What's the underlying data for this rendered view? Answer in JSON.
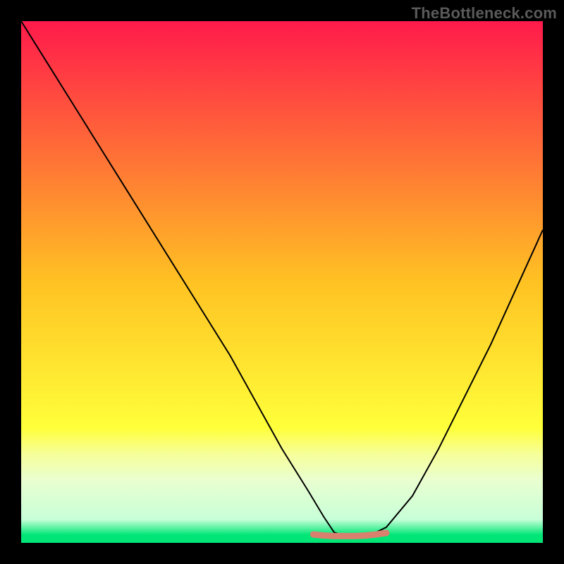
{
  "watermark": {
    "text": "TheBottleneck.com"
  },
  "chart_data": {
    "type": "line",
    "title": "",
    "xlabel": "",
    "ylabel": "",
    "xlim": [
      0,
      100
    ],
    "ylim": [
      0,
      100
    ],
    "grid": false,
    "legend": false,
    "background_gradient": {
      "stops": [
        {
          "offset": 0.0,
          "color": "#ff1a4b"
        },
        {
          "offset": 0.5,
          "color": "#ffc223"
        },
        {
          "offset": 0.78,
          "color": "#ffff3a"
        },
        {
          "offset": 0.83,
          "color": "#f6ff9a"
        },
        {
          "offset": 0.88,
          "color": "#e9ffd0"
        },
        {
          "offset": 0.955,
          "color": "#c8ffd8"
        },
        {
          "offset": 0.985,
          "color": "#00e676"
        },
        {
          "offset": 1.0,
          "color": "#00e676"
        }
      ]
    },
    "series": [
      {
        "name": "bottleneck-curve",
        "stroke": "#000000",
        "stroke_width": 2,
        "x": [
          0,
          5,
          10,
          15,
          20,
          25,
          30,
          35,
          40,
          45,
          50,
          55,
          58,
          60,
          63,
          66,
          70,
          75,
          80,
          85,
          90,
          95,
          100
        ],
        "y": [
          100,
          92,
          84,
          76,
          68,
          60,
          52,
          44,
          36,
          27,
          18,
          10,
          5,
          2,
          1,
          1,
          3,
          9,
          18,
          28,
          38,
          49,
          60
        ]
      },
      {
        "name": "optimal-zone-marker",
        "stroke": "#d9816e",
        "stroke_width": 9,
        "x": [
          56,
          58,
          60,
          62,
          64,
          66,
          68,
          70
        ],
        "y": [
          1.6,
          1.4,
          1.3,
          1.3,
          1.3,
          1.4,
          1.6,
          1.9
        ]
      }
    ]
  }
}
